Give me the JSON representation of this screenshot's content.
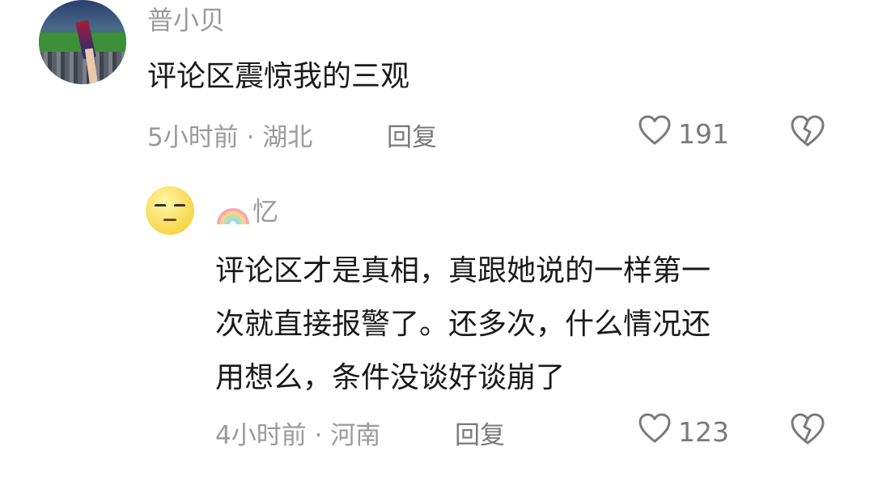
{
  "comments": [
    {
      "username": "普小贝",
      "text": "评论区震惊我的三观",
      "time_location": "5小时前 · 湖北",
      "reply_label": "回复",
      "like_count": "191",
      "avatar_icon": "stadium-photo"
    }
  ],
  "reply": {
    "username": "忆",
    "username_prefix_icon": "rainbow-icon",
    "text_lines": [
      "评论区才是真相，真跟她说的一样第一",
      "次就直接报警了。还多次，什么情况还",
      "用想么，条件没谈好谈崩了"
    ],
    "time_location": "4小时前 · 河南",
    "reply_label": "回复",
    "like_count": "123",
    "avatar_icon": "squinting-face-emoji"
  },
  "icons": {
    "like": "heart-outline-icon",
    "dislike": "broken-heart-icon"
  }
}
